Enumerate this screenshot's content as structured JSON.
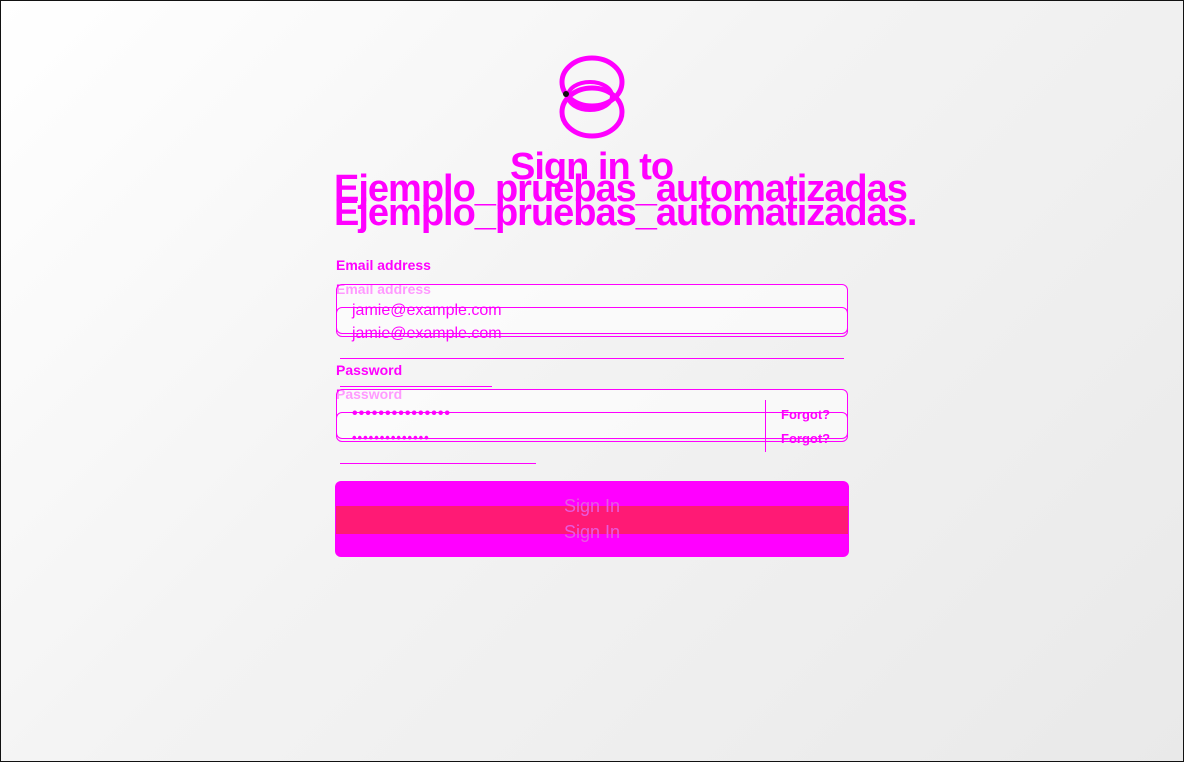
{
  "page": {
    "title_line1": "Sign in to",
    "title_line2": "Ejemplo_pruebas_automatizadas",
    "title_line2_dup": "Ejemplo_pruebas_automatizadas."
  },
  "form": {
    "email_label": "Email address",
    "email_value": "jamie@example.com",
    "password_label": "Password",
    "password_value": "•••••••••••••••",
    "password_value_dup": "••••••••••••••",
    "forgot_label": "Forgot?",
    "submit_label": "Sign In",
    "submit_label_dup": "Sign In"
  },
  "icons": {
    "logo": "interlocked-rings-logo"
  },
  "colors": {
    "accent": "#ff00ff",
    "button_inner": "#ff1a75"
  }
}
